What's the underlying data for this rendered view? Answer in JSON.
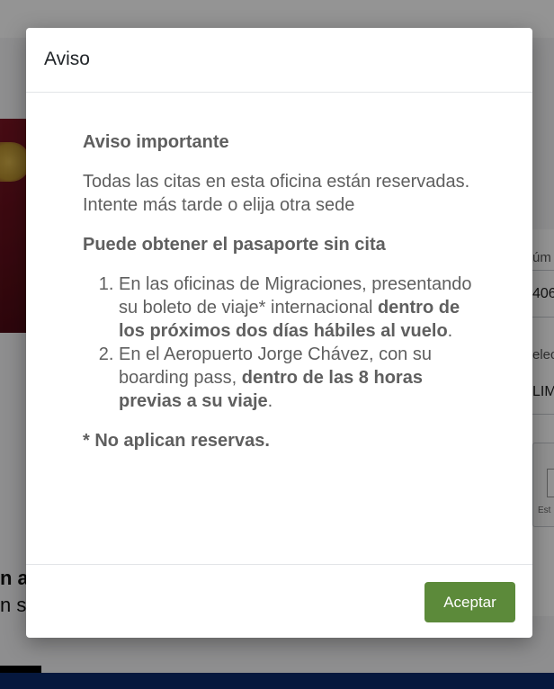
{
  "background": {
    "card_label_1": "úm",
    "card_value_1": "406",
    "card_label_2": "elec",
    "card_value_2": "LIM",
    "card_box_label": "Est",
    "left_text_1": "n a",
    "left_text_2": "n se"
  },
  "modal": {
    "title": "Aviso",
    "heading": "Aviso importante",
    "message": "Todas las citas en esta oficina están reservadas. Intente más tarde o elija otra sede",
    "subheading": "Puede obtener el pasaporte sin cita",
    "steps": [
      {
        "text": "En las oficinas de Migraciones, presentando su boleto de viaje* internacional ",
        "bold": "dentro de los próximos dos días hábiles al vuelo",
        "end": "."
      },
      {
        "text": "En el Aeropuerto Jorge Chávez, con su boarding pass, ",
        "bold": "dentro de las 8 horas previas a su viaje",
        "end": "."
      }
    ],
    "footnote": "* No aplican reservas.",
    "accept_label": "Aceptar"
  },
  "colors": {
    "accept_button": "#5c8a3a",
    "body_text": "#5f5f5f",
    "overlay": "#000000"
  }
}
